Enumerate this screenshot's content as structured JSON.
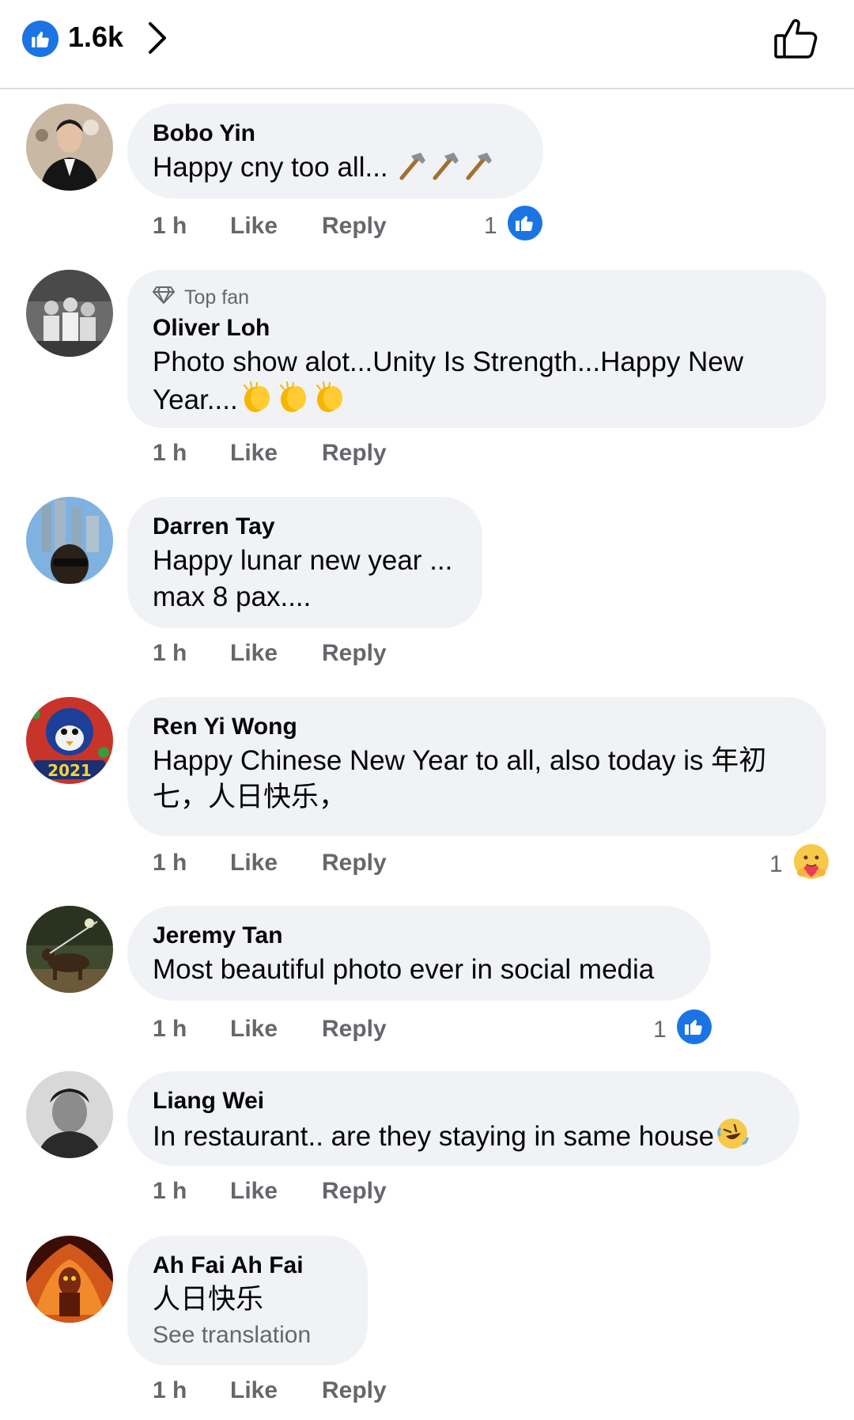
{
  "header": {
    "reaction_count": "1.6k",
    "icons": {
      "badge": "like-badge-icon",
      "chevron": "chevron-right-icon",
      "like": "thumbs-up-outline-icon"
    }
  },
  "colors": {
    "accent": "#1b74e4",
    "bubble": "#f0f2f5",
    "secondary_text": "#65676b",
    "primary_text": "#050505"
  },
  "comments": [
    {
      "author": "Bobo Yin",
      "text": "Happy cny too all... ",
      "emojis": [
        "hammer",
        "hammer",
        "hammer"
      ],
      "time": "1 h",
      "like_label": "Like",
      "reply_label": "Reply",
      "reaction_count": "1",
      "reaction_type": "like"
    },
    {
      "badge": "Top fan",
      "author": "Oliver Loh",
      "text": "Photo show alot...Unity Is Strength...Happy New Year....",
      "emojis": [
        "clapping-hands",
        "clapping-hands",
        "clapping-hands"
      ],
      "time": "1 h",
      "like_label": "Like",
      "reply_label": "Reply"
    },
    {
      "author": "Darren Tay",
      "text": "Happy lunar new year ...\nmax 8 pax....",
      "time": "1 h",
      "like_label": "Like",
      "reply_label": "Reply"
    },
    {
      "author": "Ren Yi Wong",
      "text": "Happy Chinese New Year to all, also today is 年初七，人日快乐，",
      "time": "1 h",
      "like_label": "Like",
      "reply_label": "Reply",
      "reaction_count": "1",
      "reaction_type": "care"
    },
    {
      "author": "Jeremy Tan",
      "text": "Most beautiful photo ever in social media",
      "time": "1 h",
      "like_label": "Like",
      "reply_label": "Reply",
      "reaction_count": "1",
      "reaction_type": "like"
    },
    {
      "author": "Liang Wei",
      "text": "In restaurant.. are they staying in same house",
      "emojis": [
        "rolling-on-floor-laughing"
      ],
      "time": "1 h",
      "like_label": "Like",
      "reply_label": "Reply"
    },
    {
      "author": "Ah Fai Ah Fai",
      "text": "人日快乐",
      "see_translation": "See translation",
      "time": "1 h",
      "like_label": "Like",
      "reply_label": "Reply"
    }
  ]
}
